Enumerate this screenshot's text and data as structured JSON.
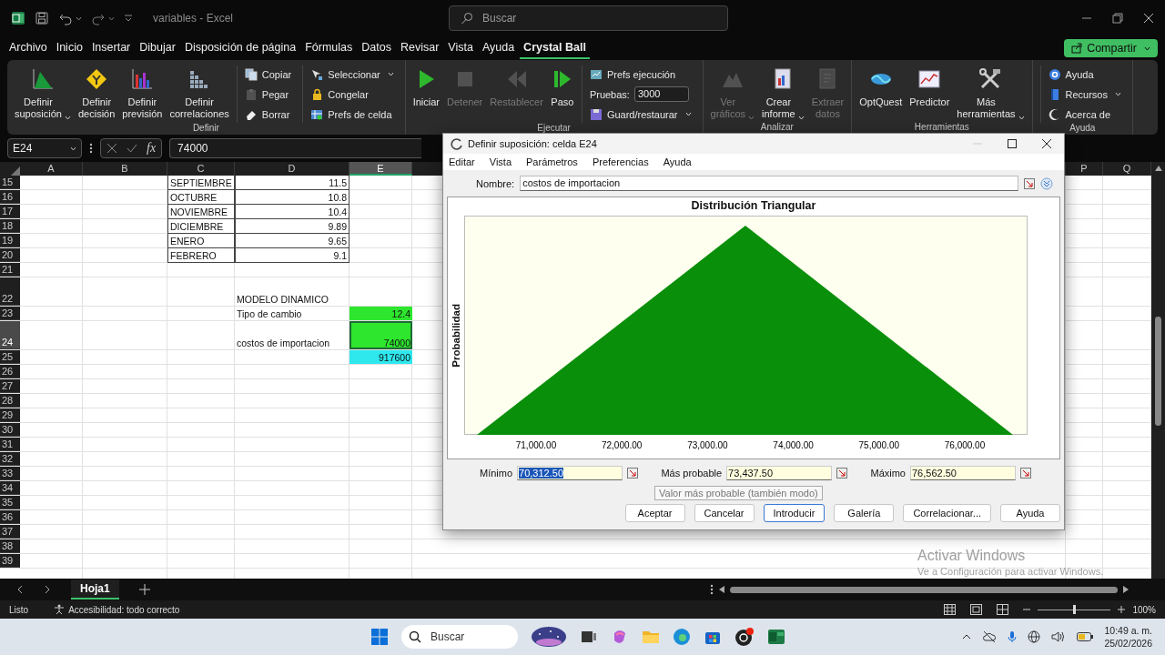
{
  "title_bar": {
    "document_title": "variables - Excel",
    "search": {
      "placeholder": "Buscar"
    }
  },
  "ribbon_tabs": [
    {
      "label": "Archivo",
      "selected": false
    },
    {
      "label": "Inicio",
      "selected": false
    },
    {
      "label": "Insertar",
      "selected": false
    },
    {
      "label": "Dibujar",
      "selected": false
    },
    {
      "label": "Disposición de página",
      "selected": false
    },
    {
      "label": "Fórmulas",
      "selected": false
    },
    {
      "label": "Datos",
      "selected": false
    },
    {
      "label": "Revisar",
      "selected": false
    },
    {
      "label": "Vista",
      "selected": false
    },
    {
      "label": "Ayuda",
      "selected": false
    },
    {
      "label": "Crystal Ball",
      "selected": true
    }
  ],
  "share_button": {
    "label": "Compartir"
  },
  "ribbon_groups": [
    {
      "label": "Definir",
      "items": [
        {
          "kind": "large",
          "label": "Definir suposición",
          "dropdown": true,
          "disabled": false
        },
        {
          "kind": "large",
          "label": "Definir decisión",
          "dropdown": false,
          "disabled": false
        },
        {
          "kind": "large",
          "label": "Definir previsión",
          "dropdown": false,
          "disabled": false
        },
        {
          "kind": "large",
          "label": "Definir correlaciones",
          "dropdown": false,
          "disabled": false
        },
        {
          "kind": "stack",
          "entries": [
            {
              "kind": "small",
              "label": "Copiar",
              "dropdown": false,
              "disabled": false
            },
            {
              "kind": "small",
              "label": "Pegar",
              "dropdown": false,
              "disabled": true
            },
            {
              "kind": "small",
              "label": "Borrar",
              "dropdown": false,
              "disabled": false
            }
          ]
        },
        {
          "kind": "stack",
          "entries": [
            {
              "kind": "small",
              "label": "Seleccionar",
              "dropdown": true,
              "disabled": false
            },
            {
              "kind": "small",
              "label": "Congelar",
              "dropdown": false,
              "disabled": false
            },
            {
              "kind": "small",
              "label": "Prefs de celda",
              "dropdown": false,
              "disabled": false
            }
          ]
        }
      ]
    },
    {
      "label": "Ejecutar",
      "items": [
        {
          "kind": "large",
          "label": "Iniciar",
          "dropdown": false,
          "disabled": false
        },
        {
          "kind": "large",
          "label": "Detener",
          "dropdown": false,
          "disabled": true
        },
        {
          "kind": "large",
          "label": "Restablecer",
          "dropdown": false,
          "disabled": true
        },
        {
          "kind": "large",
          "label": "Paso",
          "dropdown": false,
          "disabled": false
        },
        {
          "kind": "stack",
          "entries": [
            {
              "kind": "small",
              "label": "Prefs ejecución",
              "dropdown": false,
              "disabled": false
            },
            {
              "kind": "field",
              "label": "Pruebas:",
              "value": "3000"
            },
            {
              "kind": "small",
              "label": "Guard/restaurar",
              "dropdown": true,
              "disabled": false
            }
          ]
        }
      ]
    },
    {
      "label": "Analizar",
      "items": [
        {
          "kind": "large",
          "label": "Ver gráficos",
          "dropdown": true,
          "disabled": true
        },
        {
          "kind": "large",
          "label": "Crear informe",
          "dropdown": true,
          "disabled": false
        },
        {
          "kind": "large",
          "label": "Extraer datos",
          "dropdown": false,
          "disabled": true
        }
      ]
    },
    {
      "label": "Herramientas",
      "items": [
        {
          "kind": "large",
          "label": "OptQuest",
          "dropdown": false,
          "disabled": false
        },
        {
          "kind": "large",
          "label": "Predictor",
          "dropdown": false,
          "disabled": false
        },
        {
          "kind": "large",
          "label": "Más herramientas",
          "dropdown": true,
          "disabled": false
        }
      ]
    },
    {
      "label": "Ayuda",
      "items": [
        {
          "kind": "stack",
          "entries": [
            {
              "kind": "small",
              "label": "Ayuda",
              "dropdown": false,
              "disabled": false
            },
            {
              "kind": "small",
              "label": "Recursos",
              "dropdown": true,
              "disabled": false
            },
            {
              "kind": "small",
              "label": "Acerca de",
              "dropdown": false,
              "disabled": false
            }
          ]
        }
      ]
    }
  ],
  "formula_bar": {
    "name_box": "E24",
    "function_symbol": "fx",
    "formula": "74000"
  },
  "sheet": {
    "columns": [
      {
        "label": "A",
        "selected": false
      },
      {
        "label": "B",
        "selected": false
      },
      {
        "label": "C",
        "selected": false
      },
      {
        "label": "D",
        "selected": false
      },
      {
        "label": "E",
        "selected": true
      },
      {
        "label": "P",
        "selected": false
      },
      {
        "label": "Q",
        "selected": false
      }
    ],
    "rows": [
      {
        "number": "15",
        "kind": "table",
        "tall": false,
        "selected": false,
        "col_c": {
          "text": "SEPTIEMBRE"
        },
        "col_d": {
          "text": "11.5"
        }
      },
      {
        "number": "16",
        "kind": "table",
        "tall": false,
        "selected": false,
        "col_c": {
          "text": "OCTUBRE"
        },
        "col_d": {
          "text": "10.8"
        }
      },
      {
        "number": "17",
        "kind": "table",
        "tall": false,
        "selected": false,
        "col_c": {
          "text": "NOVIEMBRE"
        },
        "col_d": {
          "text": "10.4"
        }
      },
      {
        "number": "18",
        "kind": "table",
        "tall": false,
        "selected": false,
        "col_c": {
          "text": "DICIEMBRE"
        },
        "col_d": {
          "text": "9.89"
        }
      },
      {
        "number": "19",
        "kind": "table",
        "tall": false,
        "selected": false,
        "col_c": {
          "text": "ENERO"
        },
        "col_d": {
          "text": "9.65"
        }
      },
      {
        "number": "20",
        "kind": "table",
        "tall": false,
        "selected": false,
        "col_c": {
          "text": "FEBRERO"
        },
        "col_d": {
          "text": "9.1"
        }
      },
      {
        "number": "21",
        "kind": "plain",
        "tall": false,
        "selected": false
      },
      {
        "number": "22",
        "kind": "plain",
        "tall": true,
        "selected": false,
        "col_d": {
          "text": "MODELO DINAMICO"
        }
      },
      {
        "number": "23",
        "kind": "plain",
        "tall": false,
        "selected": false,
        "col_d": {
          "text": "Tipo de cambio"
        },
        "col_e": {
          "text": "12.4",
          "color": "#2ee62e",
          "selected": false
        }
      },
      {
        "number": "24",
        "kind": "plain",
        "tall": true,
        "selected": true,
        "col_d": {
          "text": "costos de importacion"
        },
        "col_e": {
          "text": "74000",
          "color": "#2ee62e",
          "selected": true
        }
      },
      {
        "number": "25",
        "kind": "plain",
        "tall": false,
        "selected": false,
        "col_e": {
          "text": "917600",
          "color": "#2ee8ee",
          "selected": false
        }
      },
      {
        "number": "26",
        "kind": "plain",
        "tall": false,
        "selected": false
      },
      {
        "number": "27",
        "kind": "plain",
        "tall": false,
        "selected": false
      },
      {
        "number": "28",
        "kind": "plain",
        "tall": false,
        "selected": false
      },
      {
        "number": "29",
        "kind": "plain",
        "tall": false,
        "selected": false
      },
      {
        "number": "30",
        "kind": "plain",
        "tall": false,
        "selected": false
      },
      {
        "number": "31",
        "kind": "plain",
        "tall": false,
        "selected": false
      },
      {
        "number": "32",
        "kind": "plain",
        "tall": false,
        "selected": false
      },
      {
        "number": "33",
        "kind": "plain",
        "tall": false,
        "selected": false
      },
      {
        "number": "34",
        "kind": "plain",
        "tall": false,
        "selected": false
      },
      {
        "number": "35",
        "kind": "plain",
        "tall": false,
        "selected": false
      },
      {
        "number": "36",
        "kind": "plain",
        "tall": false,
        "selected": false
      },
      {
        "number": "37",
        "kind": "plain",
        "tall": false,
        "selected": false
      },
      {
        "number": "38",
        "kind": "plain",
        "tall": false,
        "selected": false
      },
      {
        "number": "39",
        "kind": "plain",
        "tall": false,
        "selected": false
      }
    ]
  },
  "sheet_tabs": [
    {
      "label": "Hoja1",
      "selected": true
    }
  ],
  "status_bar": {
    "mode": "Listo",
    "accessibility": "Accesibilidad: todo correcto",
    "zoom": {
      "level": 0.5,
      "reading": "100%"
    }
  },
  "dialog": {
    "title": "Definir suposición: celda E24",
    "menu": [
      "Editar",
      "Vista",
      "Parámetros",
      "Preferencias",
      "Ayuda"
    ],
    "name_field": {
      "label": "Nombre:",
      "value": "costos de importacion"
    },
    "chart": {
      "title": "Distribución Triangular",
      "ylabel": "Probabilidad",
      "x_tick_labels": [
        "71,000.00",
        "72,000.00",
        "73,000.00",
        "74,000.00",
        "75,000.00",
        "76,000.00"
      ]
    },
    "parameters": [
      {
        "label": "Mínimo",
        "value": "70,312.50",
        "text_selected": true
      },
      {
        "label": "Más probable",
        "value": "73,437.50",
        "text_selected": false
      },
      {
        "label": "Máximo",
        "value": "76,562.50",
        "text_selected": false
      }
    ],
    "tooltip": "Valor más probable (también modo)",
    "buttons": [
      {
        "label": "Aceptar",
        "focused": false
      },
      {
        "label": "Cancelar",
        "focused": false
      },
      {
        "label": "Introducir",
        "focused": true
      },
      {
        "label": "Galería",
        "focused": false
      },
      {
        "label": "Correlacionar...",
        "focused": false
      },
      {
        "label": "Ayuda",
        "focused": false
      }
    ]
  },
  "activation_notice": {
    "title": "Activar Windows",
    "message": "Ve a Configuración para activar Windows."
  },
  "taskbar": {
    "search": {
      "placeholder": "Buscar"
    },
    "time": "10:49 a. m.",
    "date": "25/02/2026"
  }
}
